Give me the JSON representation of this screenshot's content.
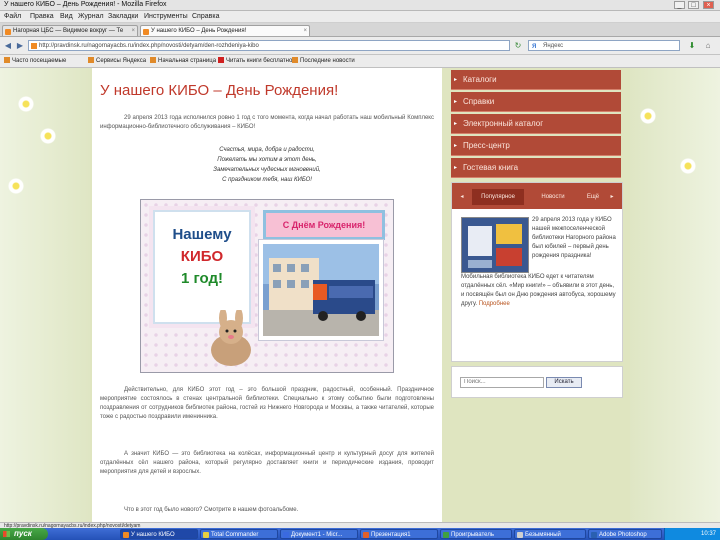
{
  "window": {
    "title": "У нашего КИБО – День Рождения! - Mozilla Firefox",
    "controls": [
      "_",
      "□",
      "×"
    ]
  },
  "menubar": {
    "items": [
      "Файл",
      "Правка",
      "Вид",
      "Журнал",
      "Закладки",
      "Инструменты",
      "Справка"
    ]
  },
  "tabs": [
    {
      "label": "Нагорная ЦБС — Видимое вокруг — Те",
      "active": false
    },
    {
      "label": "У нашего КИБО – День Рождения!",
      "active": true
    }
  ],
  "navbar": {
    "url": "http://pravdinsk.ru/nagornayacbs.ru/index.php/novosti/detyam/den-rozhdeniya-kibo",
    "search_placeholder": "Яндекс"
  },
  "bookmarks": [
    "Часто посещаемые",
    "Сервисы Яндекса",
    "Начальная страница",
    "Читать книги бесплатно",
    "Последние новости"
  ],
  "article": {
    "title": "У нашего КИБО – День Рождения!",
    "intro": "29 апреля 2013 года исполнился ровно 1 год с того момента, когда начал работать наш мобильный Комплекс информационно-библиотечного обслуживания – КИБО!",
    "poem": [
      "Счастья, мира, добра и радости,",
      "Пожелать мы хотим в этот день,",
      "Замечательных чудесных мгновений,",
      "С праздником тебя, наш КИБО!"
    ],
    "card": {
      "line1": "Нашему",
      "line2": "КИБО",
      "line3": "1 год!",
      "banner": "С Днём Рождения!"
    },
    "para2": "Действительно, для КИБО этот год – это большой праздник, радостный, особенный. Праздничное мероприятие состоялось в стенах центральной библиотеки. Специально к этому событию были подготовлены поздравления от сотрудников библиотек района, гостей из Нижнего Новгорода и Москвы, а также читателей, которые тоже с радостью поздравили именинника.",
    "para3": "А значит КИБО — это библиотека на колёсах, информационный центр и культурный досуг для жителей отдалённых сёл нашего района, который регулярно доставляет книги и периодические издания, проводит мероприятия для детей и взрослых.",
    "para4": "Что в этот год было нового? Смотрите в нашем фотоальбоме."
  },
  "sidebar": {
    "menu": [
      "Каталоги",
      "Справки",
      "Электронный каталог",
      "Пресс-центр",
      "Гостевая книга"
    ],
    "widget_tabs": [
      "Популярное",
      "Новости",
      "Ещё"
    ],
    "news_text": "29 апреля 2013 года у КИБО нашей межпоселенческой библиотеки Нагорного района был юбилей – первый день рождения праздника!",
    "news_text2": "Мобильная библиотека КИБО едет к читателям отдалённых сёл. «Мир книги!» – объявили в этот день, и посвящён был он Дню рождения автобуса, хорошему другу.",
    "more": "Подробнее",
    "search_placeholder": "Поиск...",
    "search_button": "Искать"
  },
  "statusbar": {
    "text": "http://pravdinsk.ru/nagornayacbs.ru/index.php/novosti/detyam"
  },
  "taskbar": {
    "start": "пуск",
    "items": [
      {
        "label": "У нашего КИБО",
        "active": true
      },
      {
        "label": "Total Commander",
        "active": false
      },
      {
        "label": "Документ1 - Micr...",
        "active": false
      },
      {
        "label": "Презентация1",
        "active": false
      },
      {
        "label": "Проигрыватель",
        "active": false
      },
      {
        "label": "Безымянный",
        "active": false
      },
      {
        "label": "Adobe Photoshop",
        "active": false
      }
    ],
    "clock": "10:37"
  }
}
